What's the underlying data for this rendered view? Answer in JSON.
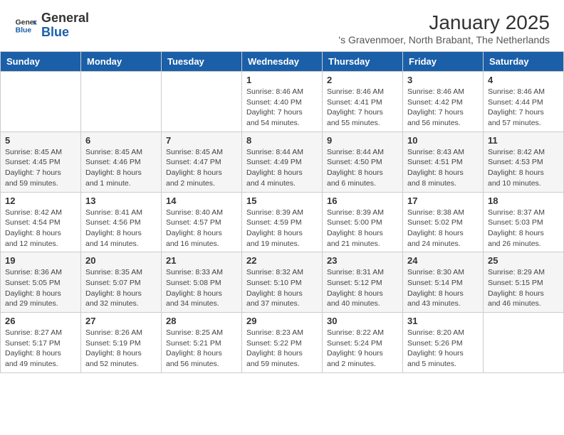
{
  "header": {
    "logo_general": "General",
    "logo_blue": "Blue",
    "title": "January 2025",
    "subtitle": "'s Gravenmoer, North Brabant, The Netherlands"
  },
  "calendar": {
    "days_of_week": [
      "Sunday",
      "Monday",
      "Tuesday",
      "Wednesday",
      "Thursday",
      "Friday",
      "Saturday"
    ],
    "weeks": [
      [
        {
          "day": "",
          "info": ""
        },
        {
          "day": "",
          "info": ""
        },
        {
          "day": "",
          "info": ""
        },
        {
          "day": "1",
          "info": "Sunrise: 8:46 AM\nSunset: 4:40 PM\nDaylight: 7 hours\nand 54 minutes."
        },
        {
          "day": "2",
          "info": "Sunrise: 8:46 AM\nSunset: 4:41 PM\nDaylight: 7 hours\nand 55 minutes."
        },
        {
          "day": "3",
          "info": "Sunrise: 8:46 AM\nSunset: 4:42 PM\nDaylight: 7 hours\nand 56 minutes."
        },
        {
          "day": "4",
          "info": "Sunrise: 8:46 AM\nSunset: 4:44 PM\nDaylight: 7 hours\nand 57 minutes."
        }
      ],
      [
        {
          "day": "5",
          "info": "Sunrise: 8:45 AM\nSunset: 4:45 PM\nDaylight: 7 hours\nand 59 minutes."
        },
        {
          "day": "6",
          "info": "Sunrise: 8:45 AM\nSunset: 4:46 PM\nDaylight: 8 hours\nand 1 minute."
        },
        {
          "day": "7",
          "info": "Sunrise: 8:45 AM\nSunset: 4:47 PM\nDaylight: 8 hours\nand 2 minutes."
        },
        {
          "day": "8",
          "info": "Sunrise: 8:44 AM\nSunset: 4:49 PM\nDaylight: 8 hours\nand 4 minutes."
        },
        {
          "day": "9",
          "info": "Sunrise: 8:44 AM\nSunset: 4:50 PM\nDaylight: 8 hours\nand 6 minutes."
        },
        {
          "day": "10",
          "info": "Sunrise: 8:43 AM\nSunset: 4:51 PM\nDaylight: 8 hours\nand 8 minutes."
        },
        {
          "day": "11",
          "info": "Sunrise: 8:42 AM\nSunset: 4:53 PM\nDaylight: 8 hours\nand 10 minutes."
        }
      ],
      [
        {
          "day": "12",
          "info": "Sunrise: 8:42 AM\nSunset: 4:54 PM\nDaylight: 8 hours\nand 12 minutes."
        },
        {
          "day": "13",
          "info": "Sunrise: 8:41 AM\nSunset: 4:56 PM\nDaylight: 8 hours\nand 14 minutes."
        },
        {
          "day": "14",
          "info": "Sunrise: 8:40 AM\nSunset: 4:57 PM\nDaylight: 8 hours\nand 16 minutes."
        },
        {
          "day": "15",
          "info": "Sunrise: 8:39 AM\nSunset: 4:59 PM\nDaylight: 8 hours\nand 19 minutes."
        },
        {
          "day": "16",
          "info": "Sunrise: 8:39 AM\nSunset: 5:00 PM\nDaylight: 8 hours\nand 21 minutes."
        },
        {
          "day": "17",
          "info": "Sunrise: 8:38 AM\nSunset: 5:02 PM\nDaylight: 8 hours\nand 24 minutes."
        },
        {
          "day": "18",
          "info": "Sunrise: 8:37 AM\nSunset: 5:03 PM\nDaylight: 8 hours\nand 26 minutes."
        }
      ],
      [
        {
          "day": "19",
          "info": "Sunrise: 8:36 AM\nSunset: 5:05 PM\nDaylight: 8 hours\nand 29 minutes."
        },
        {
          "day": "20",
          "info": "Sunrise: 8:35 AM\nSunset: 5:07 PM\nDaylight: 8 hours\nand 32 minutes."
        },
        {
          "day": "21",
          "info": "Sunrise: 8:33 AM\nSunset: 5:08 PM\nDaylight: 8 hours\nand 34 minutes."
        },
        {
          "day": "22",
          "info": "Sunrise: 8:32 AM\nSunset: 5:10 PM\nDaylight: 8 hours\nand 37 minutes."
        },
        {
          "day": "23",
          "info": "Sunrise: 8:31 AM\nSunset: 5:12 PM\nDaylight: 8 hours\nand 40 minutes."
        },
        {
          "day": "24",
          "info": "Sunrise: 8:30 AM\nSunset: 5:14 PM\nDaylight: 8 hours\nand 43 minutes."
        },
        {
          "day": "25",
          "info": "Sunrise: 8:29 AM\nSunset: 5:15 PM\nDaylight: 8 hours\nand 46 minutes."
        }
      ],
      [
        {
          "day": "26",
          "info": "Sunrise: 8:27 AM\nSunset: 5:17 PM\nDaylight: 8 hours\nand 49 minutes."
        },
        {
          "day": "27",
          "info": "Sunrise: 8:26 AM\nSunset: 5:19 PM\nDaylight: 8 hours\nand 52 minutes."
        },
        {
          "day": "28",
          "info": "Sunrise: 8:25 AM\nSunset: 5:21 PM\nDaylight: 8 hours\nand 56 minutes."
        },
        {
          "day": "29",
          "info": "Sunrise: 8:23 AM\nSunset: 5:22 PM\nDaylight: 8 hours\nand 59 minutes."
        },
        {
          "day": "30",
          "info": "Sunrise: 8:22 AM\nSunset: 5:24 PM\nDaylight: 9 hours\nand 2 minutes."
        },
        {
          "day": "31",
          "info": "Sunrise: 8:20 AM\nSunset: 5:26 PM\nDaylight: 9 hours\nand 5 minutes."
        },
        {
          "day": "",
          "info": ""
        }
      ]
    ]
  }
}
